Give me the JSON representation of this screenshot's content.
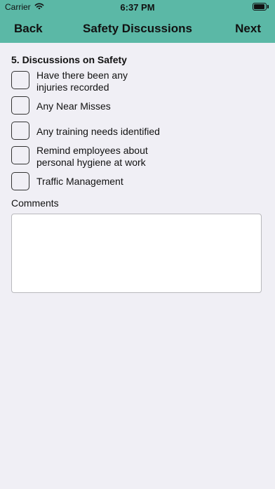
{
  "status_bar": {
    "carrier": "Carrier",
    "time": "6:37 PM",
    "wifi_icon": "wifi-icon",
    "battery_icon": "battery-icon"
  },
  "nav": {
    "back_label": "Back",
    "title": "Safety Discussions",
    "next_label": "Next"
  },
  "section": {
    "title": "5. Discussions on Safety"
  },
  "checklist": [
    {
      "label": "Have there been any\ninjuries recorded",
      "checked": false
    },
    {
      "label": "Any Near Misses",
      "checked": false
    },
    {
      "label": "Any training needs identified",
      "checked": false
    },
    {
      "label": "Remind employees about\npersonal hygiene at work",
      "checked": false
    },
    {
      "label": "Traffic Management",
      "checked": false
    }
  ],
  "comments": {
    "label": "Comments",
    "value": ""
  },
  "colors": {
    "header": "#5bb8a6",
    "background": "#f0eff5"
  }
}
